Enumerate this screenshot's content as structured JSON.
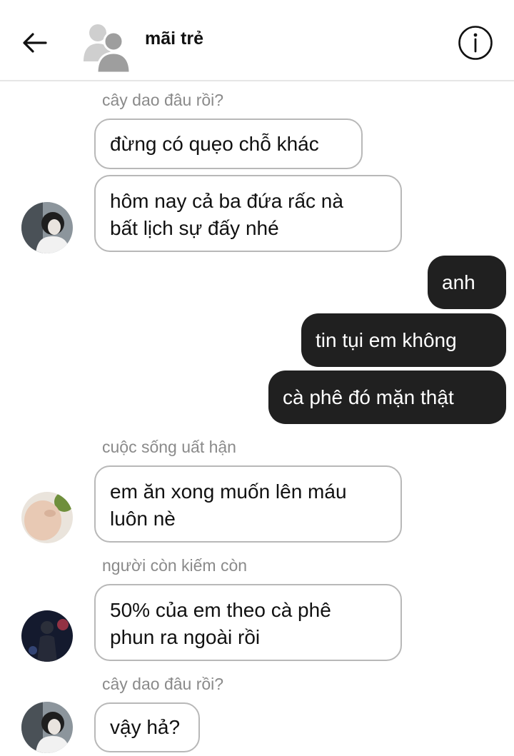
{
  "header": {
    "title": "mãi trẻ",
    "back_icon": "arrow-left-icon",
    "avatar_icon": "group-avatar-icon",
    "info_icon": "info-circle-icon"
  },
  "messages": [
    {
      "sender": "cây dao đâu rồi?",
      "lines": [
        "đừng có quẹo chỗ khác"
      ]
    },
    {
      "lines": [
        "hôm nay cả ba đứa rấc nà",
        "bất lịch sự đấy nhé"
      ]
    },
    {
      "lines": [
        "anh"
      ]
    },
    {
      "lines": [
        "tin tụi em không"
      ]
    },
    {
      "lines": [
        "cà phê đó mặn thật"
      ]
    },
    {
      "sender": "cuộc sống uất hận",
      "lines": [
        "em ăn xong muốn lên máu",
        "luôn nè"
      ]
    },
    {
      "sender": "người còn kiếm còn",
      "lines": [
        "50% của em theo cà phê",
        "phun ra ngoài rồi"
      ]
    },
    {
      "sender": "cây dao đâu rồi?",
      "lines": [
        "vậy hả?"
      ]
    }
  ],
  "colors": {
    "outgoing_bubble": "#202020",
    "incoming_border": "#b8b8b8",
    "sender_name": "#8a8a8a"
  }
}
